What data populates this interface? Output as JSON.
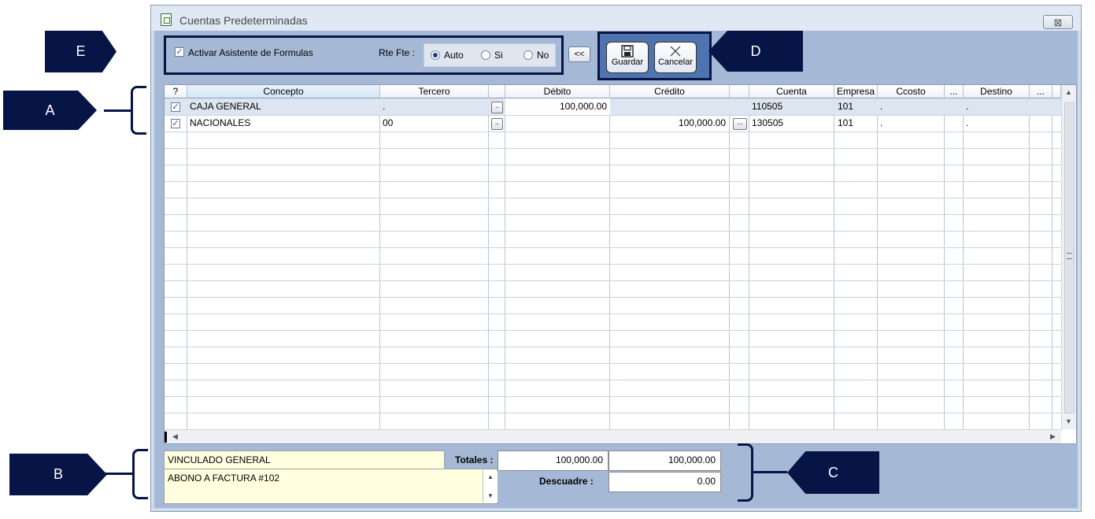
{
  "window": {
    "title": "Cuentas Predeterminadas",
    "close_glyph": "⊠"
  },
  "toolbar": {
    "asistente_label": "Activar Asistente de Formulas",
    "asistente_checked": true,
    "rte_label": "Rte Fte :",
    "radios": [
      {
        "label": "Auto",
        "selected": true
      },
      {
        "label": "Si",
        "selected": false
      },
      {
        "label": "No",
        "selected": false
      }
    ],
    "collapse_label": "<<",
    "guardar_label": "Guardar",
    "cancelar_label": "Cancelar"
  },
  "grid": {
    "columns": [
      "?",
      "Concepto",
      "Tercero",
      "",
      "Débito",
      "Crédito",
      "",
      "Cuenta",
      "Empresa",
      "Ccosto",
      "...",
      "Destino",
      "..."
    ],
    "rows": [
      {
        "checked": true,
        "concepto": "CAJA GENERAL",
        "tercero": ".",
        "debito": "100,000.00",
        "credito": "",
        "cuenta": "110505",
        "empresa": "101",
        "ccosto": ".",
        "destino": "."
      },
      {
        "checked": true,
        "concepto": "NACIONALES",
        "tercero": "00",
        "debito": "",
        "credito": "100,000.00",
        "cuenta": "130505",
        "empresa": "101",
        "ccosto": ".",
        "destino": "."
      }
    ]
  },
  "footer": {
    "vinculado": "VINCULADO GENERAL",
    "abono": "ABONO A FACTURA #102",
    "totales_label": "Totales :",
    "total_debito": "100,000.00",
    "total_credito": "100,000.00",
    "descuadre_label": "Descuadre :",
    "descuadre_value": "0.00"
  },
  "callouts": {
    "a": "A",
    "b": "B",
    "c": "C",
    "d": "D",
    "e": "E"
  },
  "colors": {
    "callout_navy": "#061546",
    "client_bg": "#a5b8d5",
    "note_bg": "#ffffe0"
  }
}
